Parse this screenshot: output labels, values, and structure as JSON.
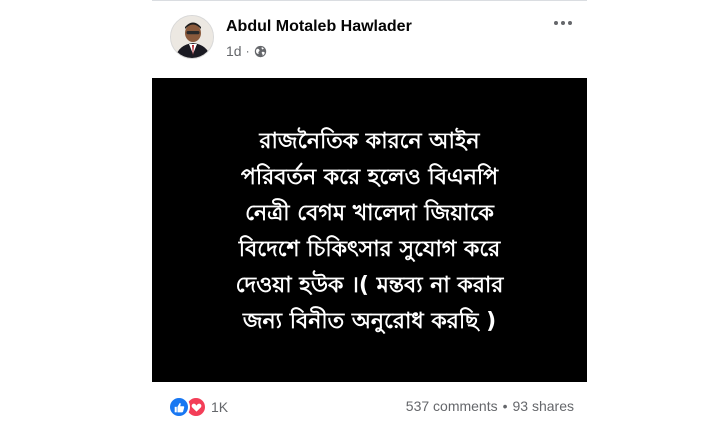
{
  "post": {
    "author_name": "Abdul Motaleb Hawlader",
    "timestamp": "1d",
    "separator": "·",
    "privacy_icon": "globe-icon",
    "more_icon": "more-horizontal-icon",
    "media_text_lines": [
      "রাজনৈতিক কারনে আইন",
      "পরিবর্তন করে হলেও বিএনপি",
      "নেত্রী বেগম খালেদা জিয়াকে",
      "বিদেশে চিকিৎসার সুযোগ করে",
      "দেওয়া হউক ।( মন্তব্য না করার",
      "জন্য বিনীত অনুরোধ করছি )"
    ]
  },
  "footer": {
    "reaction_icons": [
      "like-icon",
      "love-icon"
    ],
    "reaction_count": "1K",
    "comments": "537 comments",
    "stats_separator": "•",
    "shares": "93 shares"
  },
  "colors": {
    "media_background": "#000000",
    "media_text": "#ffffff",
    "like_blue": "#1877f2",
    "love_red": "#f33e58",
    "secondary_text": "#65676b"
  }
}
